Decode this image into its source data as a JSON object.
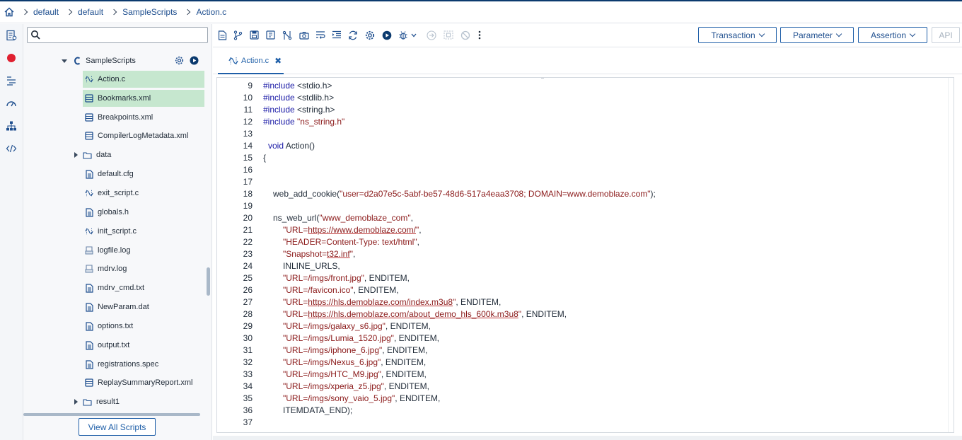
{
  "breadcrumb": [
    "default",
    "default",
    "SampleScripts",
    "Action.c"
  ],
  "search": {
    "placeholder": ""
  },
  "tree": {
    "root": "SampleScripts",
    "items": [
      {
        "label": "Action.c",
        "icon": "c-file-icon",
        "selected": true
      },
      {
        "label": "Bookmarks.xml",
        "icon": "xml-file-icon",
        "selected": true
      },
      {
        "label": "Breakpoints.xml",
        "icon": "xml-file-icon"
      },
      {
        "label": "CompilerLogMetadata.xml",
        "icon": "xml-file-icon"
      },
      {
        "label": "data",
        "icon": "folder-icon"
      },
      {
        "label": "default.cfg",
        "icon": "file-icon"
      },
      {
        "label": "exit_script.c",
        "icon": "c-file-icon"
      },
      {
        "label": "globals.h",
        "icon": "file-icon"
      },
      {
        "label": "init_script.c",
        "icon": "c-file-icon"
      },
      {
        "label": "logfile.log",
        "icon": "log-file-icon"
      },
      {
        "label": "mdrv.log",
        "icon": "log-file-icon"
      },
      {
        "label": "mdrv_cmd.txt",
        "icon": "file-icon"
      },
      {
        "label": "NewParam.dat",
        "icon": "file-icon"
      },
      {
        "label": "options.txt",
        "icon": "file-icon"
      },
      {
        "label": "output.txt",
        "icon": "file-icon"
      },
      {
        "label": "registrations.spec",
        "icon": "file-icon"
      },
      {
        "label": "ReplaySummaryReport.xml",
        "icon": "xml-file-icon"
      },
      {
        "label": "result1",
        "icon": "folder-icon"
      }
    ]
  },
  "view_all_label": "View All Scripts",
  "toolbar": {
    "transaction_label": "Transaction",
    "parameter_label": "Parameter",
    "assertion_label": "Assertion",
    "api_label": "API"
  },
  "tab": {
    "label": "Action.c",
    "close": "✖"
  },
  "code": {
    "line_numbers": [
      "9",
      "10",
      "11",
      "12",
      "13",
      "14",
      "15",
      "16",
      "17",
      "18",
      "19",
      "20",
      "21",
      "22",
      "23",
      "24",
      "25",
      "26",
      "27",
      "28",
      "29",
      "30",
      "31",
      "32",
      "33",
      "34",
      "35",
      "36",
      "37"
    ],
    "lines": {
      "l9_kw": "#include",
      "l9_rest": " <stdio.h>",
      "l10_kw": "#include",
      "l10_rest": " <stdlib.h>",
      "l11_kw": "#include",
      "l11_rest": " <string.h>",
      "l12_kw": "#include",
      "l12_str": " \"ns_string.h\"",
      "l14_kw": "void",
      "l14_rest": " Action()",
      "l15": "{",
      "l18_pre": "web_add_cookie(",
      "l18_str": "\"user=d2a07e5c-5abf-be57-48d6-517a4eaa3708; DOMAIN=www.demoblaze.com\"",
      "l18_post": ");",
      "l20_pre": "ns_web_url(",
      "l20_str": "\"www_demoblaze_com\"",
      "l20_post": ",",
      "l21_a": "\"URL=",
      "l21_url": "https://www.demoblaze.com/",
      "l21_b": "\"",
      "l21_post": ",",
      "l22_str": "\"HEADER=Content-Type: text/html\"",
      "l22_post": ",",
      "l23_a": "\"Snapshot=",
      "l23_url": "t32.inf",
      "l23_b": "\"",
      "l23_post": ",",
      "l24": "INLINE_URLS,",
      "l25_str": "\"URL=/imgs/front.jpg\"",
      "l25_post": ", ENDITEM,",
      "l26_str": "\"URL=/favicon.ico\"",
      "l26_post": ", ENDITEM,",
      "l27_a": "\"URL=",
      "l27_url": "https://hls.demoblaze.com/index.m3u8",
      "l27_b": "\"",
      "l27_post": ", ENDITEM,",
      "l28_a": "\"URL=",
      "l28_url": "https://hls.demoblaze.com/about_demo_hls_600k.m3u8",
      "l28_b": "\"",
      "l28_post": ", ENDITEM,",
      "l29_str": "\"URL=/imgs/galaxy_s6.jpg\"",
      "l29_post": ", ENDITEM,",
      "l30_str": "\"URL=/imgs/Lumia_1520.jpg\"",
      "l30_post": ", ENDITEM,",
      "l31_str": "\"URL=/imgs/iphone_6.jpg\"",
      "l31_post": ", ENDITEM,",
      "l32_str": "\"URL=/imgs/Nexus_6.jpg\"",
      "l32_post": ", ENDITEM,",
      "l33_str": "\"URL=/imgs/HTC_M9.jpg\"",
      "l33_post": ", ENDITEM,",
      "l34_str": "\"URL=/imgs/xperia_z5.jpg\"",
      "l34_post": ", ENDITEM,",
      "l35_str": "\"URL=/imgs/sony_vaio_5.jpg\"",
      "l35_post": ", ENDITEM,",
      "l36": "ITEMDATA_END);"
    }
  },
  "colors": {
    "accent": "#1f5fa8",
    "selection": "#c6e7cf",
    "keyword": "#1a1aa6",
    "string": "#8b1a1a"
  }
}
